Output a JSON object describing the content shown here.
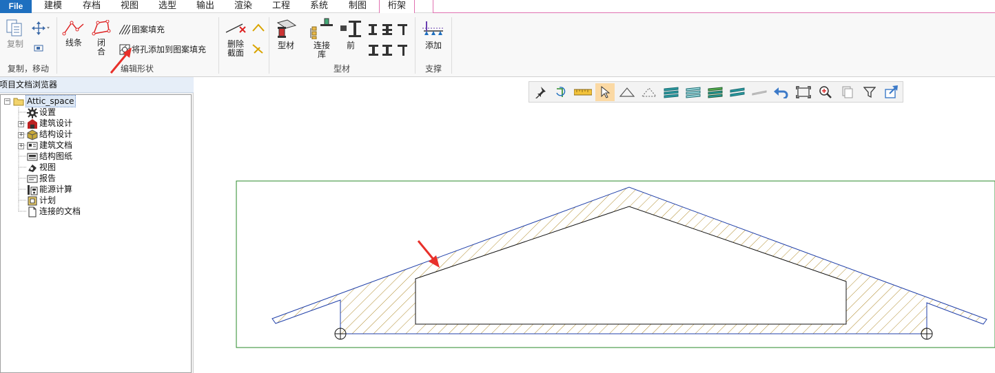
{
  "menu": {
    "file": "File",
    "items": [
      "建模",
      "存档",
      "视图",
      "选型",
      "输出",
      "渲染",
      "工程",
      "系统",
      "制图"
    ],
    "active": "桁架"
  },
  "ribbon": {
    "copy_move": {
      "copy": "复制",
      "label": "复制，移动"
    },
    "edit_shape": {
      "line": "线条",
      "close": "闭\n合",
      "hatch_fill": "图案填充",
      "add_hole": "将孔添加到图案填充",
      "label": "编辑形状"
    },
    "delete_section": "删除\n截面",
    "profiles": {
      "profile": "型材",
      "library": "连接\n库",
      "front": "前",
      "label": "型材"
    },
    "support": {
      "add": "添加",
      "label": "支撑"
    }
  },
  "browser": {
    "title": "项目文档浏览器",
    "root": "Attic_space",
    "items": [
      "设置",
      "建筑设计",
      "结构设计",
      "建筑文档",
      "结构图纸",
      "视图",
      "报告",
      "能源计算",
      "计划",
      "连接的文档"
    ]
  },
  "colors": {
    "accent": "#1e6fbf",
    "active_tab_border": "#e070b0",
    "hatch": "#b08a2a",
    "outline": "#1f3fa8",
    "frame": "#2a8a2a",
    "arrow": "#e8302a"
  }
}
